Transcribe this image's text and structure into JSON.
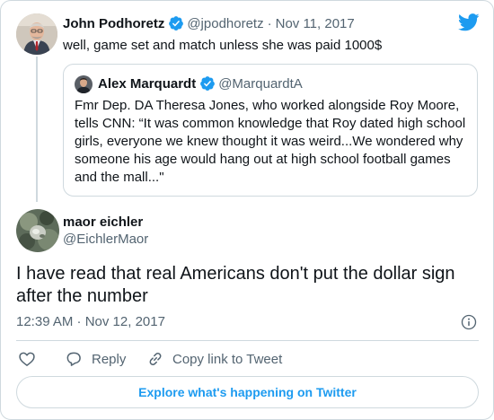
{
  "tweet_parent": {
    "name": "John Podhoretz",
    "handle": "@jpodhoretz",
    "separator": "·",
    "date": "Nov 11, 2017",
    "text": "well, game set and match unless she was paid 1000$"
  },
  "quoted_tweet": {
    "name": "Alex Marquardt",
    "handle": "@MarquardtA",
    "text": "Fmr Dep. DA Theresa Jones, who worked alongside Roy Moore, tells CNN: “It was common knowledge that Roy dated high school girls, everyone we knew thought it was weird...We wondered why someone his age would hang out at high school football games and the mall...\""
  },
  "tweet_main": {
    "name": "maor eichler",
    "handle": "@EichlerMaor",
    "text": "I have read that real Americans don't put the dollar sign after the number",
    "timestamp": "12:39 AM · Nov 12, 2017"
  },
  "actions": {
    "reply_label": "Reply",
    "copy_link_label": "Copy link to Tweet"
  },
  "footer": {
    "explore_label": "Explore what's happening on Twitter"
  },
  "colors": {
    "accent": "#1d9bf0",
    "muted": "#536471",
    "border": "#cfd9de"
  }
}
